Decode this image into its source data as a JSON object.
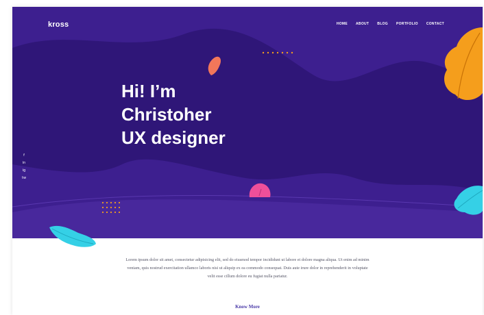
{
  "site": {
    "logo": "kross",
    "nav": [
      "HOME",
      "ABOUT",
      "BLOG",
      "PORTFOLIO",
      "CONTACT"
    ]
  },
  "hero": {
    "line1": "Hi! I’m",
    "line2": "Christoher",
    "line3": "UX designer",
    "social_icons": [
      "f",
      "in",
      "ig",
      "tw"
    ]
  },
  "intro": {
    "text": "Lorem ipsum dolor sit amet, consectetur adipisicing elit, sed do eiusmod tempor incididunt ut labore et dolore magna aliqua. Ut enim ad minim veniam, quis nostrud exercitation ullamco laboris nisi ut aliquip ex ea commodo consequat. Duis aute irure dolor in reprehenderit in voluptate velit esse cillum dolore eu fugiat nulla pariatur.",
    "link": "Know More"
  },
  "colors": {
    "hero_bg": "#3d1f8f",
    "blob_dark": "#2f1678",
    "accent_orange": "#f59e1c",
    "accent_coral": "#f2775a",
    "accent_pink": "#ef4f9a",
    "accent_cyan": "#35d0e6",
    "link": "#4a3aa8"
  }
}
